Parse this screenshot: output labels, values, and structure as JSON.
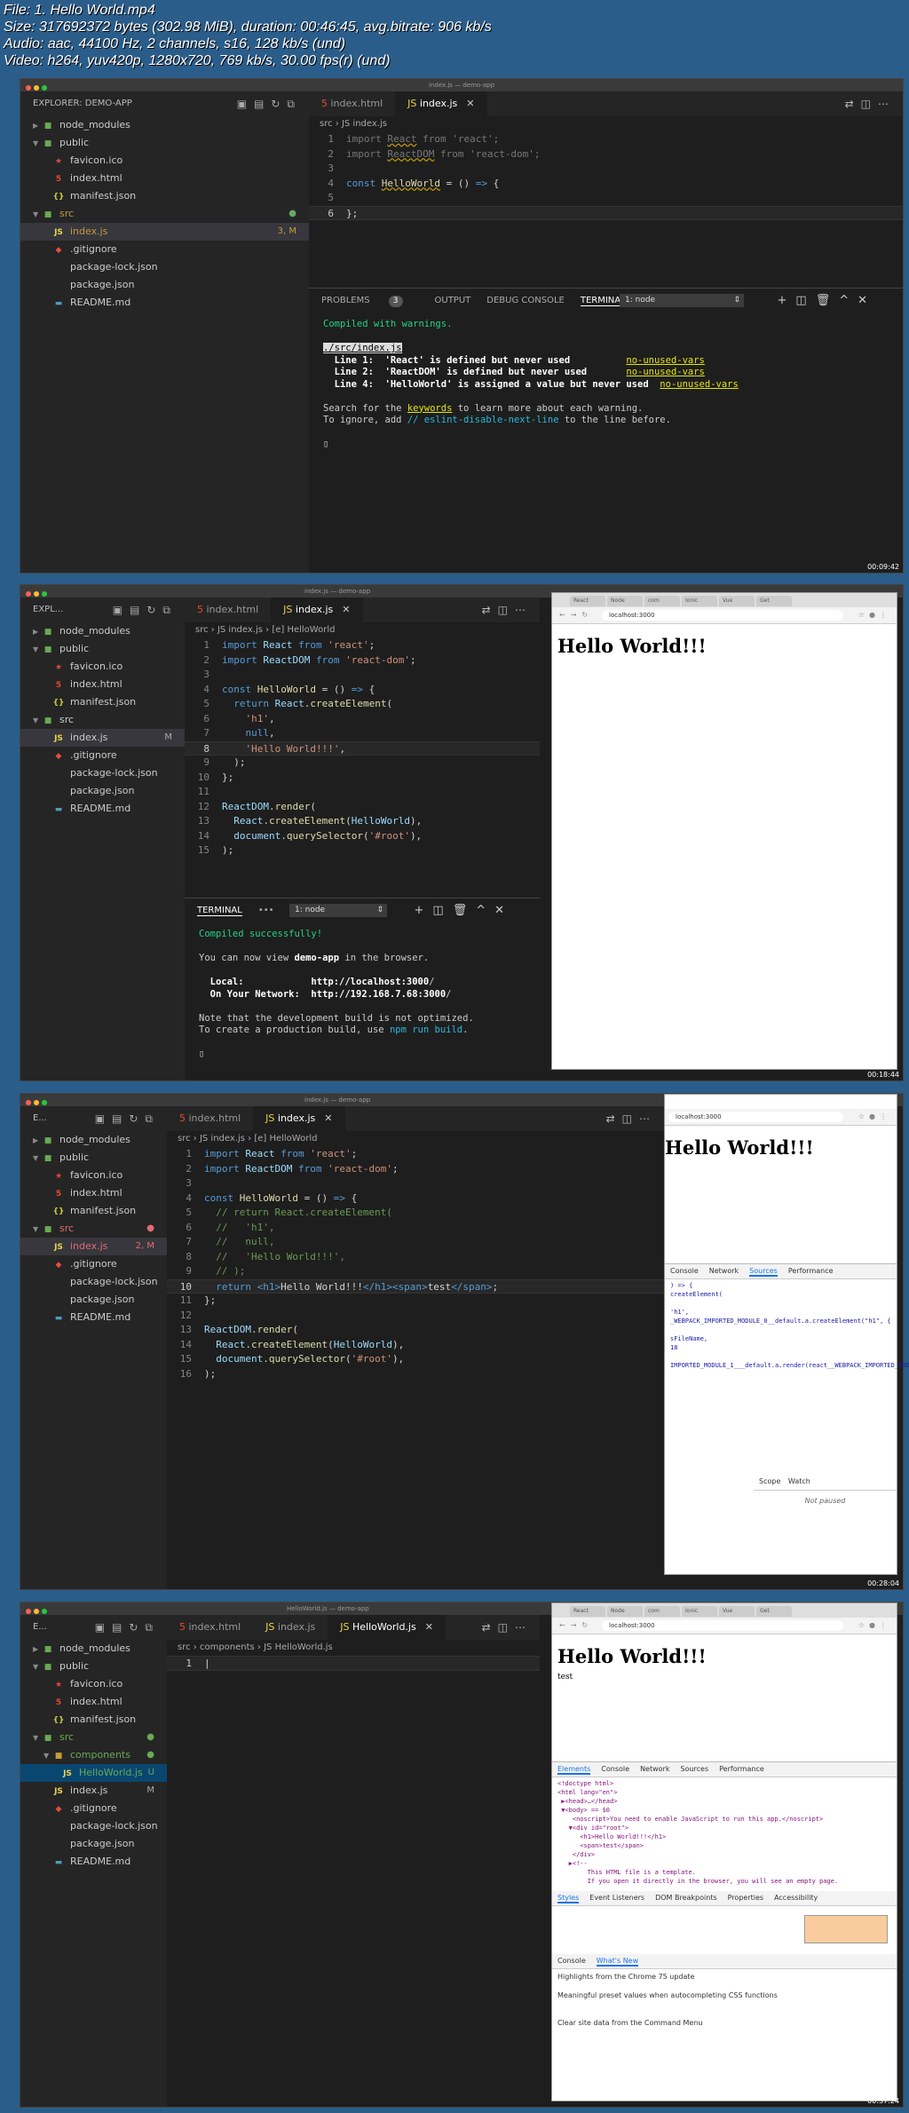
{
  "info": {
    "line1": "File: 1. Hello World.mp4",
    "line2": "Size: 317692372 bytes (302.98 MiB), duration: 00:46:45, avg.bitrate: 906 kb/s",
    "line3": "Audio: aac, 44100 Hz, 2 channels, s16, 128 kb/s (und)",
    "line4": "Video: h264, yuv420p, 1280x720, 769 kb/s, 30.00 fps(r) (und)"
  },
  "titles": {
    "f1": "index.js — demo-app",
    "f2": "index.js — demo-app",
    "f3": "index.js — demo-app",
    "f4": "HelloWorld.js — demo-app"
  },
  "explorer": {
    "head_full": "EXPLORER: DEMO-APP",
    "head_short": "EXPL...",
    "head_tiny": "E...",
    "items": [
      "node_modules",
      "public",
      "favicon.ico",
      "index.html",
      "manifest.json",
      "src",
      "index.js",
      ".gitignore",
      "package-lock.json",
      "package.json",
      "README.md"
    ],
    "components": "components",
    "helloworld_js": "HelloWorld.js",
    "badge_3m": "3, M",
    "badge_m": "M",
    "badge_2m": "2, M",
    "badge_u": "U"
  },
  "tabs": {
    "index_html": "index.html",
    "index_js": "index.js",
    "helloworld_js": "HelloWorld.js"
  },
  "crumbs": {
    "f1": "src › JS index.js",
    "f2": "src › JS index.js › [e] HelloWorld",
    "f3": "src › JS index.js › [e] HelloWorld",
    "f4": "src › components › JS HelloWorld.js"
  },
  "panel": {
    "problems": "PROBLEMS",
    "problems_count": "3",
    "output": "OUTPUT",
    "debug": "DEBUG CONSOLE",
    "terminal": "TERMINAL",
    "node": "1: node"
  },
  "term1": {
    "l1": "Compiled with warnings.",
    "l2": "./src/index.js",
    "w1a": "  Line 1:  'React' is defined but never used          ",
    "w1b": "no-unused-vars",
    "w2a": "  Line 2:  'ReactDOM' is defined but never used       ",
    "w2b": "no-unused-vars",
    "w3a": "  Line 4:  'HelloWorld' is assigned a value but never used  ",
    "w3b": "no-unused-vars",
    "s1a": "Search for the ",
    "s1b": "keywords",
    "s1c": " to learn more about each warning.",
    "s2a": "To ignore, add ",
    "s2b": "// eslint-disable-next-line",
    "s2c": " to the line before."
  },
  "term2": {
    "l1": "Compiled successfully!",
    "l2a": "You can now view ",
    "l2b": "demo-app",
    "l2c": " in the browser.",
    "local": "  Local:            http://localhost:",
    "local_port": "3000",
    "local_end": "/",
    "net": "  On Your Network:  http://192.168.7.68:",
    "net_port": "3000",
    "net_end": "/",
    "n1": "Note that the development build is not optimized.",
    "n2a": "To create a production build, use ",
    "n2b": "npm run build",
    "n2c": "."
  },
  "browser": {
    "url": "localhost:3000",
    "heading": "Hello World!!!",
    "text": "test",
    "tabs": [
      "React",
      "Node",
      "com",
      "Ionic",
      "Vue",
      "Get"
    ]
  },
  "devtools": {
    "elements": "Elements",
    "console": "Console",
    "network": "Network",
    "sources": "Sources",
    "performance": "Performance",
    "scope": "Scope",
    "watch": "Watch",
    "not_paused": "Not paused",
    "styles": "Styles",
    "event_listeners": "Event Listeners",
    "dom_breakpoints": "DOM Breakpoints",
    "properties": "Properties",
    "accessibility": "Accessibility",
    "whats_new": "What's New",
    "highlights": "Highlights from the Chrome 75 update",
    "meaningful": "Meaningful preset values when autocompleting CSS functions",
    "clear_site": "Clear site data from the Command Menu"
  },
  "timestamps": {
    "f1": "00:09:42",
    "f2": "00:18:44",
    "f3": "00:28:04",
    "f4": "00:37:24"
  }
}
